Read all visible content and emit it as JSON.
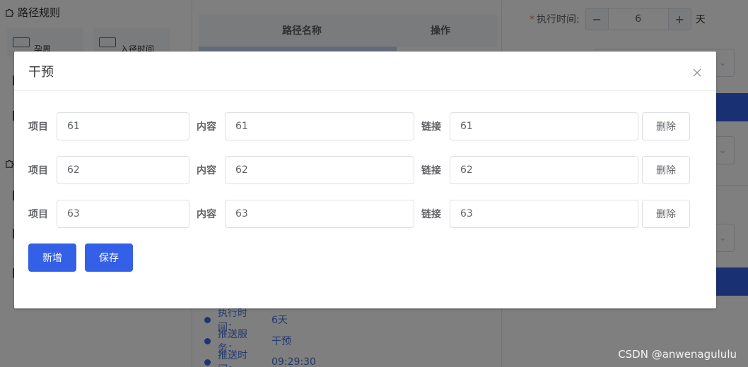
{
  "background": {
    "left": {
      "section_title": "路径规则",
      "cards": [
        "孕周",
        "入径时间"
      ]
    },
    "middle": {
      "table_headers": [
        "路径名称",
        "操作"
      ],
      "timeline": [
        {
          "key": "执行时间：",
          "value": "6天"
        },
        {
          "key": "推送服务：",
          "value": "干预"
        },
        {
          "key": "推送时间：",
          "value": "09:29:30"
        }
      ]
    },
    "right": {
      "required_mark": "*",
      "exec_label": "执行时间:",
      "exec_minus": "−",
      "exec_value": "6",
      "exec_plus": "+",
      "exec_unit": "天"
    }
  },
  "dialog": {
    "title": "干预",
    "labels": {
      "item": "项目",
      "content": "内容",
      "link": "链接"
    },
    "rows": [
      {
        "item": "61",
        "content": "61",
        "link": "61",
        "delete_label": "删除"
      },
      {
        "item": "62",
        "content": "62",
        "link": "62",
        "delete_label": "删除"
      },
      {
        "item": "63",
        "content": "63",
        "link": "63",
        "delete_label": "删除"
      }
    ],
    "add_label": "新增",
    "save_label": "保存"
  },
  "watermark": "CSDN @anwenagululu",
  "colors": {
    "primary": "#3360e6",
    "mask": "rgba(0,0,0,0.5)"
  }
}
